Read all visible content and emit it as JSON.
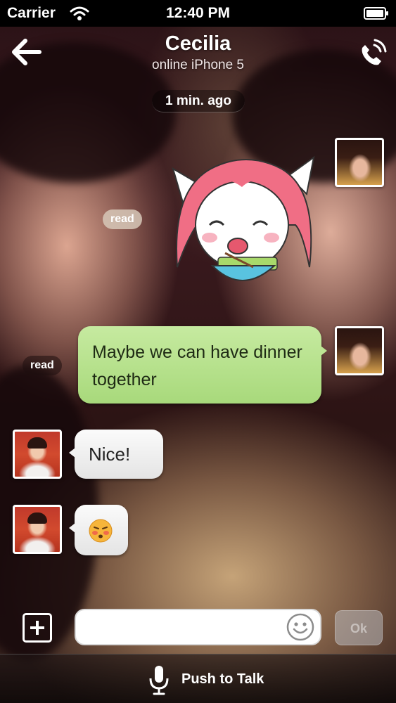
{
  "status_bar": {
    "carrier": "Carrier",
    "time": "12:40 PM"
  },
  "nav": {
    "title": "Cecilia",
    "subtitle": "online iPhone 5"
  },
  "timestamp": "1 min. ago",
  "messages": [
    {
      "from": "me",
      "type": "sticker",
      "read_label": "read"
    },
    {
      "from": "me",
      "type": "text",
      "text": "Maybe we can have dinner together",
      "read_label": "read"
    },
    {
      "from": "contact",
      "type": "text",
      "text": "Nice!"
    },
    {
      "from": "contact",
      "type": "emoji",
      "icon": "blushing-face-emoji"
    }
  ],
  "input": {
    "placeholder": "",
    "value": "",
    "send_label": "Ok"
  },
  "push_to_talk": {
    "label": "Push to Talk"
  },
  "colors": {
    "outgoing_bubble": "#b5e08a",
    "incoming_bubble": "#f0f0f0",
    "sticker_hair": "#f06e85"
  }
}
